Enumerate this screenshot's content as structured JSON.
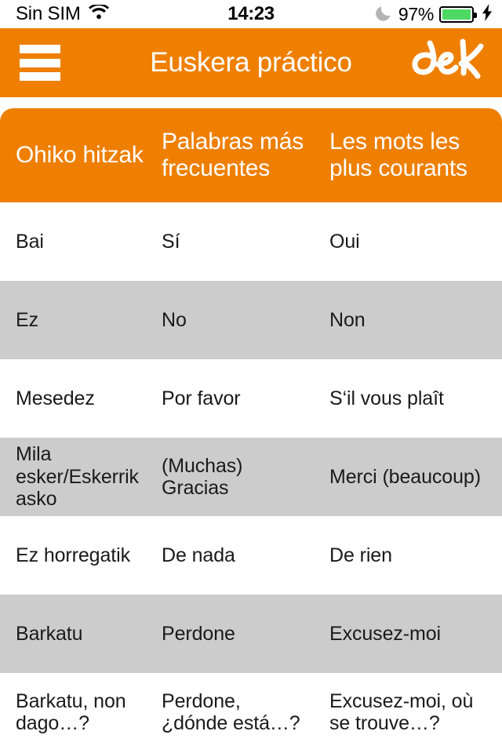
{
  "status_bar": {
    "carrier": "Sin SIM",
    "wifi_icon": "wifi-icon",
    "time": "14:23",
    "dnd_icon": "moon-icon",
    "battery_percent": "97%",
    "battery_icon": "battery-icon",
    "charging_icon": "lightning-bolt-icon"
  },
  "nav_bar": {
    "menu_icon": "hamburger-menu-icon",
    "title": "Euskera práctico",
    "logo_text": "aek",
    "background_color": "#ee7f00"
  },
  "table": {
    "headers": [
      "Ohiko hitzak",
      "Palabras más frecuentes",
      "Les mots les plus courants"
    ],
    "rows": [
      {
        "eu": "Bai",
        "es": "Sí",
        "fr": "Oui"
      },
      {
        "eu": "Ez",
        "es": "No",
        "fr": "Non"
      },
      {
        "eu": "Mesedez",
        "es": "Por favor",
        "fr": "S‘il vous plaît"
      },
      {
        "eu": "Mila esker/Eskerrik asko",
        "es": "(Muchas) Gracias",
        "fr": "Merci (beaucoup)"
      },
      {
        "eu": "Ez horregatik",
        "es": "De nada",
        "fr": "De rien"
      },
      {
        "eu": "Barkatu",
        "es": "Perdone",
        "fr": "Excusez-moi"
      },
      {
        "eu": "Barkatu, non dago…?",
        "es": "Perdone, ¿dónde está…?",
        "fr": "Excusez-moi, où se trouve…?"
      }
    ]
  },
  "colors": {
    "accent_orange": "#ee7f00",
    "row_alt_gray": "#cccccc",
    "row_base_white": "#ffffff",
    "battery_green": "#4cd964",
    "text_dark": "#1a1a1a"
  }
}
